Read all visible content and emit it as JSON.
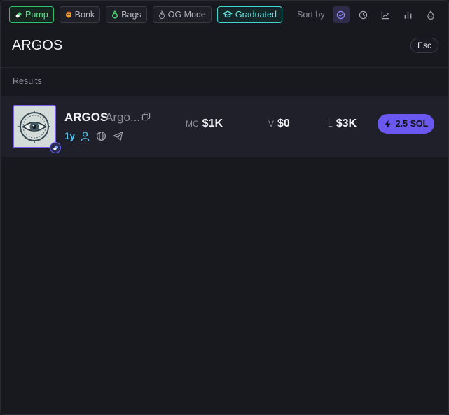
{
  "filters": [
    {
      "label": "Pump",
      "icon": "pill-icon",
      "state": "active"
    },
    {
      "label": "Bonk",
      "icon": "bonk-icon",
      "state": "inactive"
    },
    {
      "label": "Bags",
      "icon": "bags-icon",
      "state": "inactive"
    },
    {
      "label": "OG Mode",
      "icon": "flame-icon",
      "state": "inactive"
    },
    {
      "label": "Graduated",
      "icon": "graduation-cap-icon",
      "state": "active"
    }
  ],
  "sort": {
    "label": "Sort by",
    "options": [
      "relevance-icon",
      "clock-icon",
      "line-chart-icon",
      "bar-chart-icon",
      "liquidity-drop-icon"
    ],
    "active": "relevance-icon"
  },
  "search": {
    "value": "ARGOS",
    "esc_label": "Esc"
  },
  "results_label": "Results",
  "results": [
    {
      "symbol": "ARGOS",
      "name": "Argo...",
      "age": "1y",
      "mc_label": "MC",
      "mc_value": "$1K",
      "v_label": "V",
      "v_value": "$0",
      "l_label": "L",
      "l_value": "$3K",
      "buy_label": "2.5 SOL"
    }
  ],
  "colors": {
    "background": "#18181f",
    "row": "#20202a",
    "accent": "#6b58f0",
    "pump_green": "#58e08f",
    "graduated_teal": "#66ece4",
    "age_blue": "#54c8ee"
  }
}
